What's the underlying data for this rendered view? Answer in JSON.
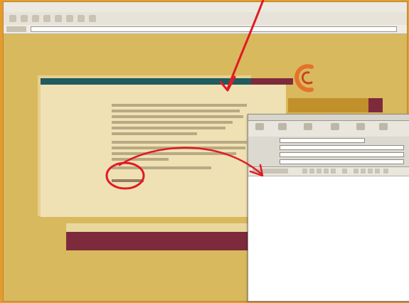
{
  "browser": {
    "title": "",
    "address": ""
  },
  "page": {
    "nav": [
      "",
      "",
      "",
      "",
      "",
      ""
    ],
    "article_title": ""
  },
  "brand": {
    "logo_text": "",
    "gold_label": ""
  },
  "compose": {
    "window_title": "",
    "fields": [
      {
        "label": "",
        "value": ""
      },
      {
        "label": "",
        "value": ""
      },
      {
        "label": "",
        "value": ""
      },
      {
        "label": "",
        "value": ""
      }
    ],
    "body": ""
  },
  "annotations": {
    "colors": {
      "accent": "#e01a25"
    },
    "icon": "red-pen-marks"
  },
  "colors": {
    "frame": "#e79a2a",
    "page_bg": "#d9b95d",
    "nav_bg": "#1f5b5f",
    "maroon": "#7d2a3c",
    "gold": "#c1902a"
  }
}
